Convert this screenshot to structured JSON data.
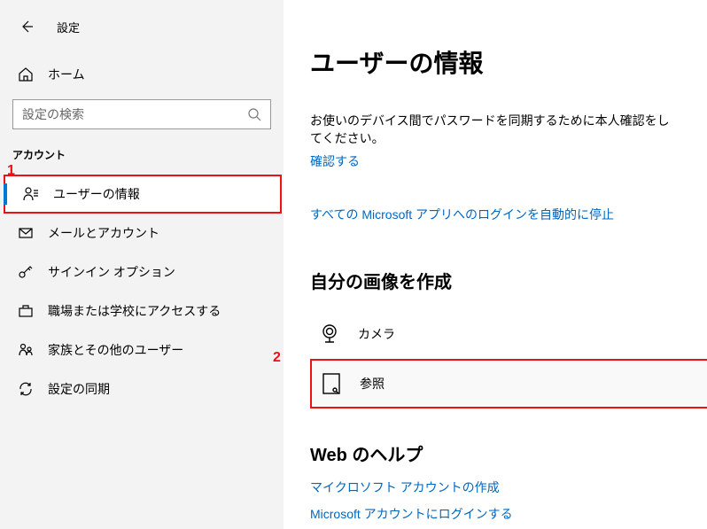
{
  "header": {
    "title": "設定"
  },
  "sidebar": {
    "home_label": "ホーム",
    "search_placeholder": "設定の検索",
    "section_label": "アカウント",
    "items": [
      {
        "label": "ユーザーの情報"
      },
      {
        "label": "メールとアカウント"
      },
      {
        "label": "サインイン オプション"
      },
      {
        "label": "職場または学校にアクセスする"
      },
      {
        "label": "家族とその他のユーザー"
      },
      {
        "label": "設定の同期"
      }
    ]
  },
  "annotations": {
    "one": "1",
    "two": "2"
  },
  "main": {
    "page_title": "ユーザーの情報",
    "sync_desc": "お使いのデバイス間でパスワードを同期するために本人確認をしてください。",
    "verify_link": "確認する",
    "stop_login_link": "すべての Microsoft アプリへのログインを自動的に停止",
    "create_image_heading": "自分の画像を作成",
    "camera_label": "カメラ",
    "browse_label": "参照",
    "web_help_heading": "Web のヘルプ",
    "help_link1": "マイクロソフト アカウントの作成",
    "help_link2": "Microsoft アカウントにログインする"
  }
}
